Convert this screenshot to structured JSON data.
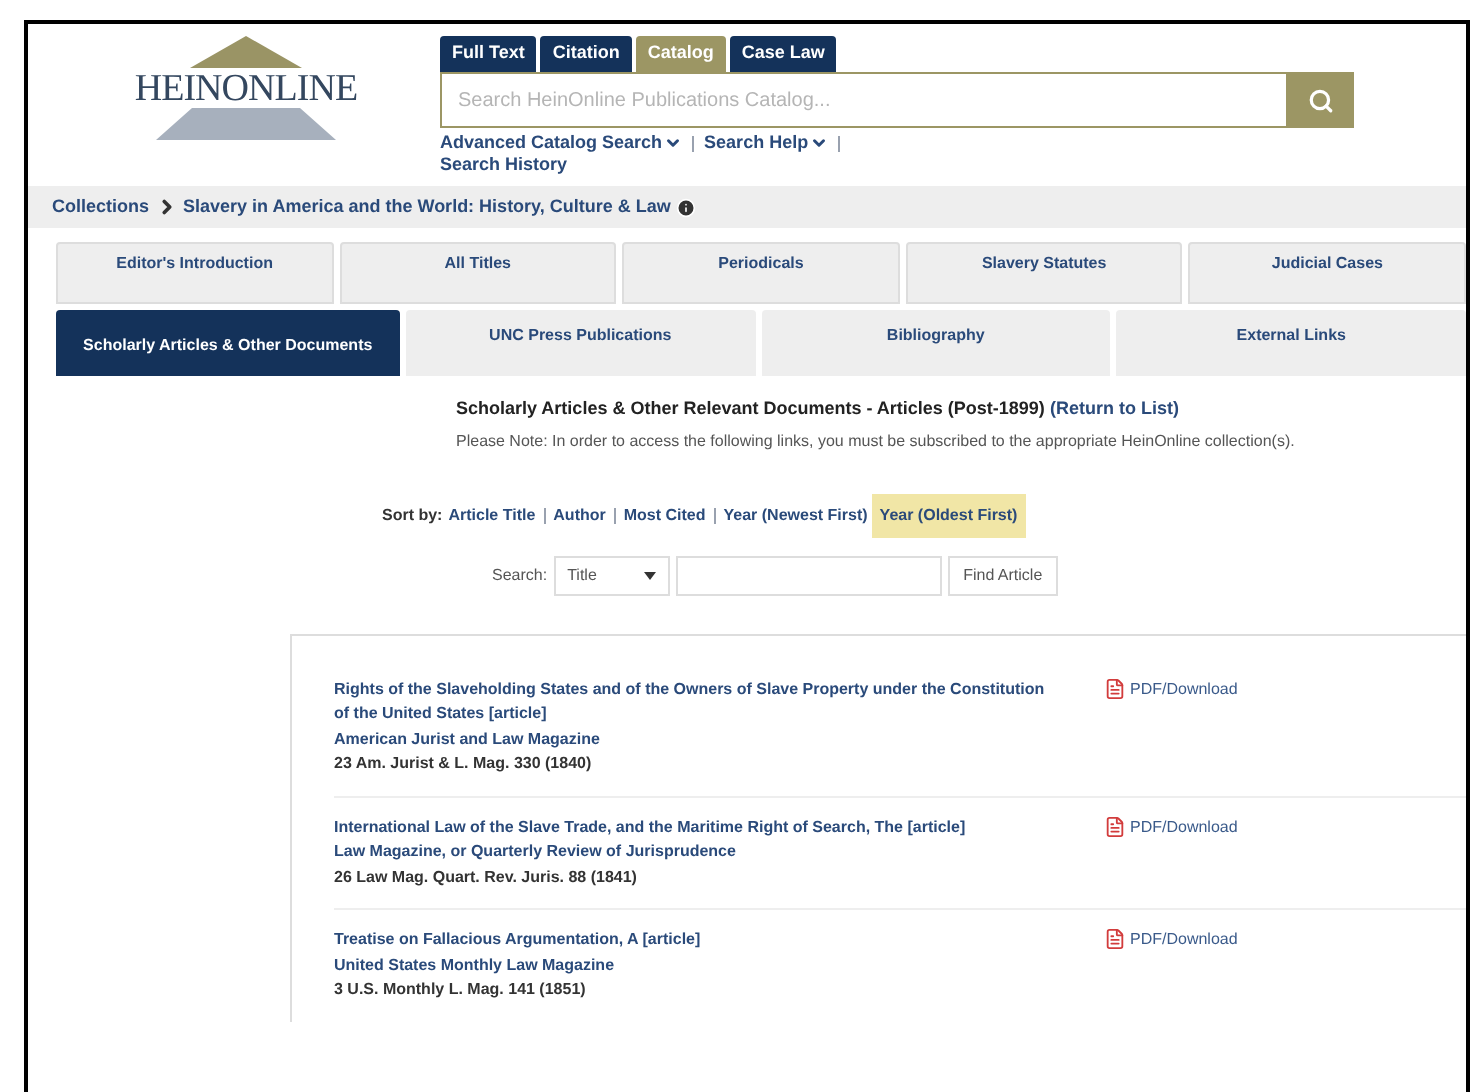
{
  "logo": {
    "text": "HEINONLINE"
  },
  "search_tabs": [
    {
      "label": "Full Text",
      "selected": false
    },
    {
      "label": "Citation",
      "selected": false
    },
    {
      "label": "Catalog",
      "selected": true
    },
    {
      "label": "Case Law",
      "selected": false
    }
  ],
  "search": {
    "placeholder": "Search HeinOnline Publications Catalog..."
  },
  "search_links": [
    {
      "label": "Advanced Catalog Search",
      "dropdown": true
    },
    {
      "label": "Search Help",
      "dropdown": true
    },
    {
      "label": "Search History",
      "dropdown": false
    }
  ],
  "breadcrumb": [
    "Collections",
    "Slavery in America and the World: History, Culture & Law"
  ],
  "tabs_row_1": [
    {
      "label": "Editor's Introduction",
      "selected": false
    },
    {
      "label": "All Titles",
      "selected": false
    },
    {
      "label": "Periodicals",
      "selected": false
    },
    {
      "label": "Slavery Statutes",
      "selected": false
    },
    {
      "label": "Judicial Cases",
      "selected": false
    }
  ],
  "tabs_row_2": [
    {
      "label": "Scholarly Articles & Other Documents",
      "selected": true
    },
    {
      "label": "UNC Press Publications",
      "selected": false
    },
    {
      "label": "Bibliography",
      "selected": false
    },
    {
      "label": "External Links",
      "selected": false
    }
  ],
  "heading": "Scholarly Articles & Other Relevant Documents - Articles (Post-1899)",
  "return_link": "(Return to List)",
  "note": "Please Note: In order to access the following links, you must be subscribed to the appropriate HeinOnline collection(s).",
  "sort": {
    "label": "Sort by:",
    "options": [
      {
        "label": "Article Title",
        "selected": false
      },
      {
        "label": "Author",
        "selected": false
      },
      {
        "label": "Most Cited",
        "selected": false
      },
      {
        "label": "Year (Newest First)",
        "selected": false
      },
      {
        "label": "Year (Oldest First)",
        "selected": true
      }
    ]
  },
  "article_search": {
    "label": "Search:",
    "field": "Title",
    "button": "Find Article"
  },
  "articles": [
    {
      "title": "Rights of the Slaveholding States and of the Owners of Slave Property under the Constitution of the United States [article]",
      "journal": "American Jurist and Law Magazine",
      "citation": "23 Am. Jurist & L. Mag. 330 (1840)",
      "download": "PDF/Download"
    },
    {
      "title": "International Law of the Slave Trade, and the Maritime Right of Search, The [article]",
      "journal": "Law Magazine, or Quarterly Review of Jurisprudence",
      "citation": "26 Law Mag. Quart. Rev. Juris. 88 (1841)",
      "download": "PDF/Download"
    },
    {
      "title": "Treatise on Fallacious Argumentation, A [article]",
      "journal": "United States Monthly Law Magazine",
      "citation": "3 U.S. Monthly L. Mag. 141 (1851)",
      "download": "PDF/Download"
    }
  ]
}
